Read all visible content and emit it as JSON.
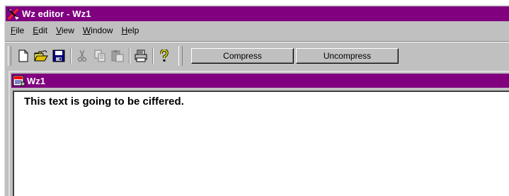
{
  "window": {
    "title": "Wz editor - Wz1",
    "accent_color": "#800080"
  },
  "menu": {
    "items": [
      {
        "mnemonic": "F",
        "rest": "ile"
      },
      {
        "mnemonic": "E",
        "rest": "dit"
      },
      {
        "mnemonic": "V",
        "rest": "iew"
      },
      {
        "mnemonic": "W",
        "rest": "indow"
      },
      {
        "mnemonic": "H",
        "rest": "elp"
      }
    ]
  },
  "toolbar": {
    "icons": [
      "new-file-icon",
      "open-folder-icon",
      "save-disk-icon",
      "cut-scissors-icon",
      "copy-icon",
      "paste-icon",
      "print-icon",
      "help-question-icon"
    ],
    "compress_label": "Compress",
    "uncompress_label": "Uncompress"
  },
  "document": {
    "title": "Wz1",
    "text": "This text is going to be ciffered."
  }
}
